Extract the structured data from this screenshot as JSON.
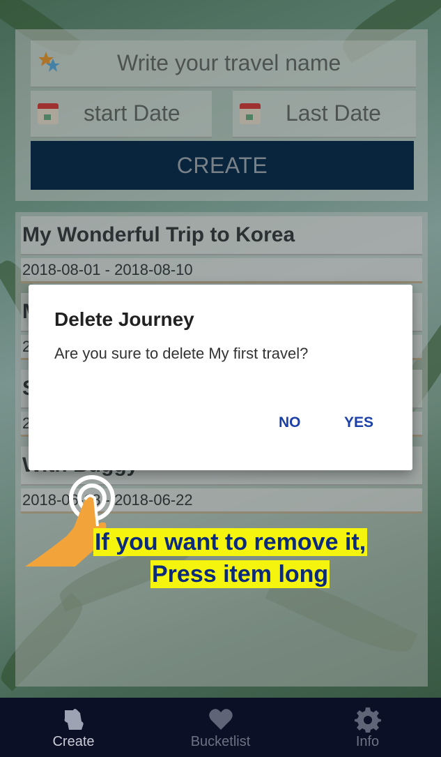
{
  "form": {
    "travel_name_placeholder": "Write your travel name",
    "start_date_placeholder": "start Date",
    "last_date_placeholder": "Last Date",
    "create_label": "CREATE"
  },
  "journeys": [
    {
      "title": "My Wonderful Trip to Korea",
      "dates": "2018-08-01 - 2018-08-10"
    },
    {
      "title": "M",
      "dates": "2"
    },
    {
      "title": "S",
      "dates": "2"
    },
    {
      "title": "With Buggy",
      "dates": "2018-06-18 - 2018-06-22"
    }
  ],
  "dialog": {
    "title": "Delete Journey",
    "message": "Are you sure to delete My first travel?",
    "no_label": "NO",
    "yes_label": "YES"
  },
  "tooltip": {
    "line1": "If you want to remove it,",
    "line2": "Press item long"
  },
  "bottom_nav": {
    "tabs": [
      {
        "label": "Create",
        "icon": "puzzle-icon",
        "active": true
      },
      {
        "label": "Bucketlist",
        "icon": "heart-icon",
        "active": false
      },
      {
        "label": "Info",
        "icon": "gear-icon",
        "active": false
      }
    ]
  },
  "colors": {
    "accent": "#0d3457",
    "dialog_button": "#1a3fa8",
    "tooltip_highlight": "#f4f40f",
    "nav_background": "#0b1026"
  }
}
